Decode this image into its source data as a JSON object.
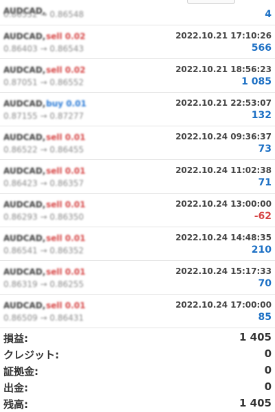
{
  "trades": [
    {
      "symbol": "AUDCAD, ",
      "direction": "",
      "dir_class": "sell",
      "prices": "0.86552 → 0.86548",
      "time": "",
      "profit": "4",
      "profit_class": ""
    },
    {
      "symbol": "AUDCAD, ",
      "direction": "sell 0.02",
      "dir_class": "sell",
      "prices": "0.86403 → 0.86543",
      "time": "2022.10.21 17:10:26",
      "profit": "566",
      "profit_class": ""
    },
    {
      "symbol": "AUDCAD, ",
      "direction": "sell 0.02",
      "dir_class": "sell",
      "prices": "0.87051 → 0.86552",
      "time": "2022.10.21 18:56:23",
      "profit": "1 085",
      "profit_class": ""
    },
    {
      "symbol": "AUDCAD, ",
      "direction": "buy 0.01",
      "dir_class": "buy",
      "prices": "0.87155 → 0.87277",
      "time": "2022.10.21 22:53:07",
      "profit": "132",
      "profit_class": ""
    },
    {
      "symbol": "AUDCAD, ",
      "direction": "sell 0.01",
      "dir_class": "sell",
      "prices": "0.86522 → 0.86455",
      "time": "2022.10.24 09:36:37",
      "profit": "73",
      "profit_class": ""
    },
    {
      "symbol": "AUDCAD, ",
      "direction": "sell 0.01",
      "dir_class": "sell",
      "prices": "0.86423 → 0.86357",
      "time": "2022.10.24 11:02:38",
      "profit": "71",
      "profit_class": ""
    },
    {
      "symbol": "AUDCAD, ",
      "direction": "sell 0.01",
      "dir_class": "sell",
      "prices": "0.86293 → 0.86350",
      "time": "2022.10.24 13:00:00",
      "profit": "-62",
      "profit_class": "neg"
    },
    {
      "symbol": "AUDCAD, ",
      "direction": "sell 0.01",
      "dir_class": "sell",
      "prices": "0.86541 → 0.86352",
      "time": "2022.10.24 14:48:35",
      "profit": "210",
      "profit_class": ""
    },
    {
      "symbol": "AUDCAD, ",
      "direction": "sell 0.01",
      "dir_class": "sell",
      "prices": "0.86319 → 0.86255",
      "time": "2022.10.24 15:17:33",
      "profit": "70",
      "profit_class": ""
    },
    {
      "symbol": "AUDCAD, ",
      "direction": "sell 0.01",
      "dir_class": "sell",
      "prices": "0.86509 → 0.86431",
      "time": "2022.10.24 17:00:00",
      "profit": "85",
      "profit_class": ""
    }
  ],
  "summary": [
    {
      "label": "損益:",
      "value": "1 405"
    },
    {
      "label": "クレジット:",
      "value": "0"
    },
    {
      "label": "証拠金:",
      "value": "0"
    },
    {
      "label": "出金:",
      "value": "0"
    },
    {
      "label": "残高:",
      "value": "1 405"
    }
  ],
  "colors": {
    "profit_positive": "#1b6fc4",
    "profit_negative": "#d64545",
    "sell": "#d64545",
    "buy": "#2a7ad6"
  }
}
